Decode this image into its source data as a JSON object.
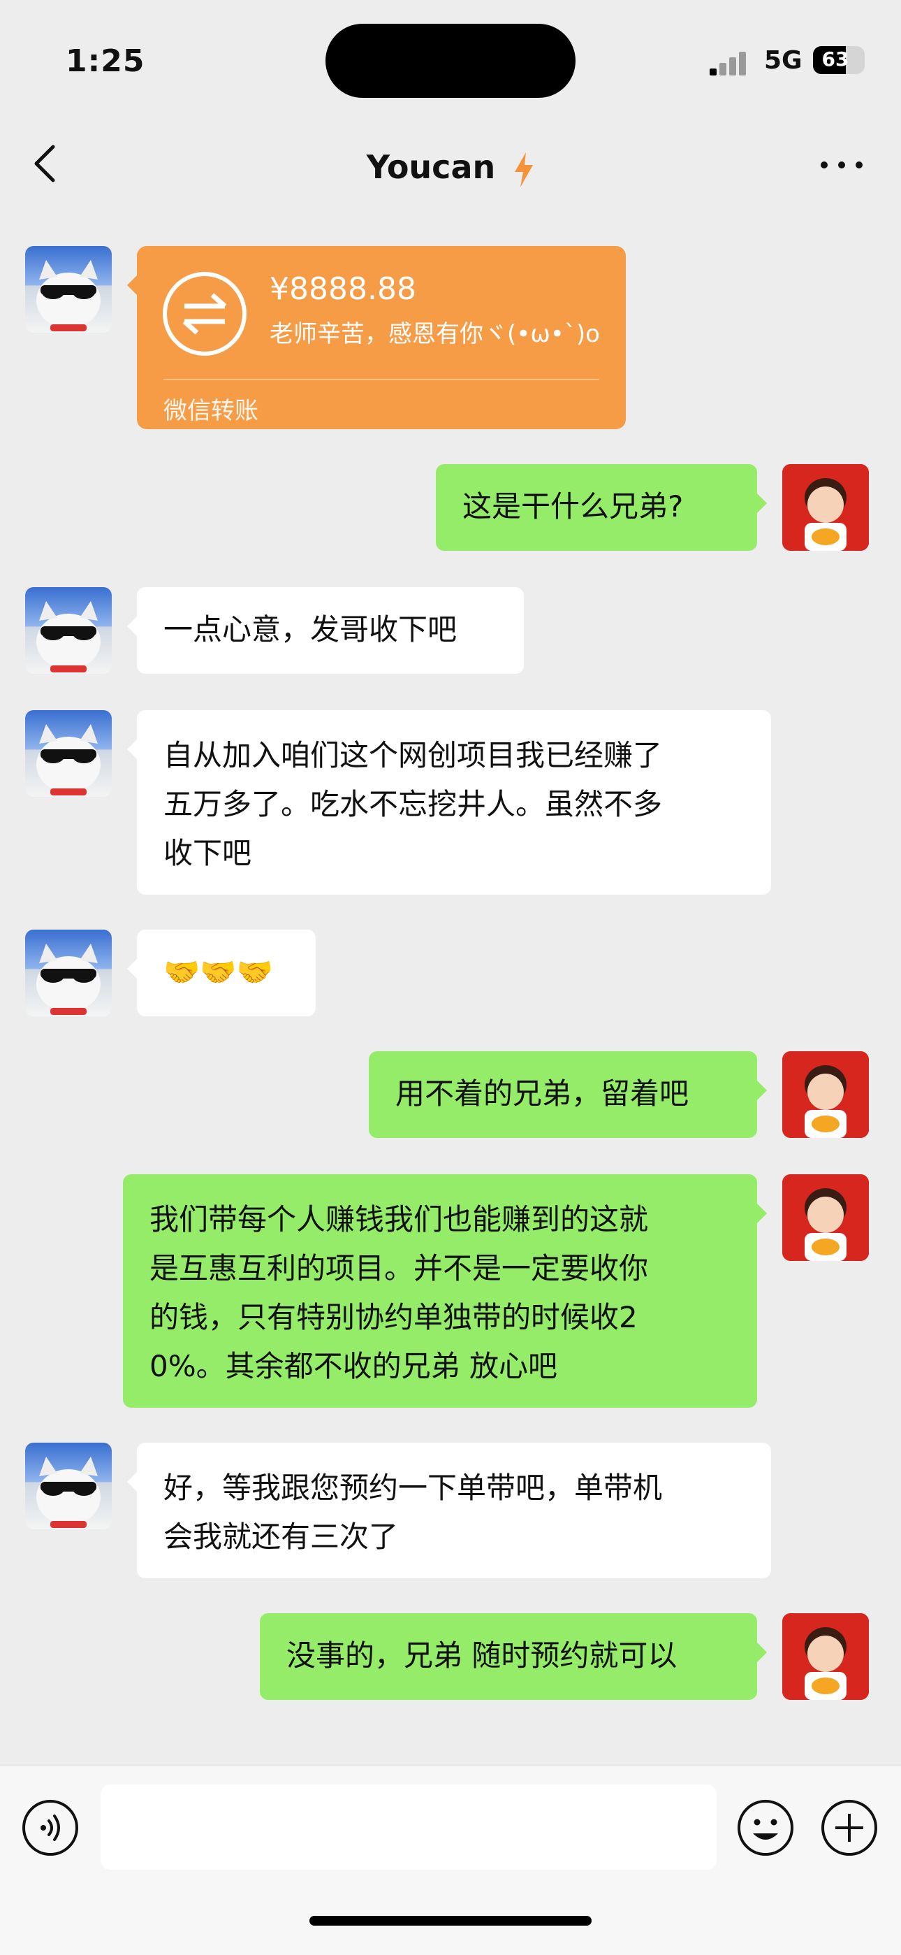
{
  "status_bar": {
    "time": "1:25",
    "network": "5G",
    "battery": "63",
    "battery_level": 0.63
  },
  "nav": {
    "title": "Youcan"
  },
  "transfer": {
    "amount": "¥8888.88",
    "note": "老师辛苦，感恩有你ヾ(•ω•`)o",
    "label": "微信转账"
  },
  "messages": [
    {
      "side": "right",
      "text": "这是干什么兄弟?"
    },
    {
      "side": "left",
      "text": "一点心意，发哥收下吧"
    },
    {
      "side": "left",
      "lines": [
        "自从加入咱们这个网创项目我已经赚了",
        "五万多了。吃水不忘挖井人。虽然不多",
        "收下吧"
      ]
    },
    {
      "side": "left",
      "text": "🤝🤝🤝"
    },
    {
      "side": "right",
      "text": "用不着的兄弟，留着吧"
    },
    {
      "side": "right",
      "lines": [
        "我们带每个人赚钱我们也能赚到的这就",
        "是互惠互利的项目。并不是一定要收你",
        "的钱，只有特别协约单独带的时候收2",
        "0%。其余都不收的兄弟 放心吧"
      ]
    },
    {
      "side": "left",
      "lines": [
        "好，等我跟您预约一下单带吧，单带机",
        "会我就还有三次了"
      ]
    },
    {
      "side": "right",
      "text": "没事的，兄弟 随时预约就可以"
    }
  ],
  "colors": {
    "background": "#EDEDED",
    "outgoing_bubble": "#95EC69",
    "incoming_bubble": "#FFFFFF",
    "transfer_card": "#F79C46"
  },
  "icons": [
    "back-arrow-icon",
    "lightning-icon",
    "more-dots-icon",
    "transfer-arrows-icon",
    "voice-icon",
    "emoji-icon",
    "plus-icon"
  ]
}
